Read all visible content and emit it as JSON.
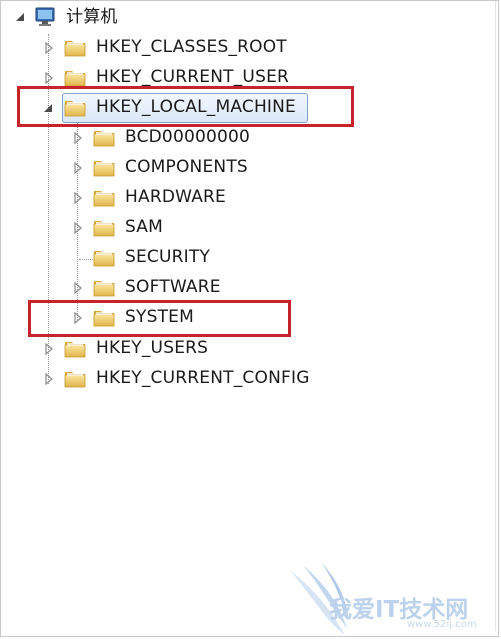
{
  "tree": {
    "root": {
      "label": "计算机",
      "icon": "computer-icon",
      "expanded": true
    },
    "hives": [
      {
        "label": "HKEY_CLASSES_ROOT",
        "expanded": false
      },
      {
        "label": "HKEY_CURRENT_USER",
        "expanded": false
      },
      {
        "label": "HKEY_LOCAL_MACHINE",
        "expanded": true,
        "selected": true
      },
      {
        "label": "HKEY_USERS",
        "expanded": false
      },
      {
        "label": "HKEY_CURRENT_CONFIG",
        "expanded": false
      }
    ],
    "local_machine_children": [
      {
        "label": "BCD00000000",
        "has_children": true
      },
      {
        "label": "COMPONENTS",
        "has_children": true
      },
      {
        "label": "HARDWARE",
        "has_children": true
      },
      {
        "label": "SAM",
        "has_children": true
      },
      {
        "label": "SECURITY",
        "has_children": false
      },
      {
        "label": "SOFTWARE",
        "has_children": true
      },
      {
        "label": "SYSTEM",
        "has_children": true
      }
    ]
  },
  "annotations": {
    "highlight_color": "#c8232c"
  },
  "watermark": {
    "text": "我爱IT技术网",
    "url": "www.52ij.com"
  },
  "colors": {
    "folder": "#e8c35a",
    "selection": "#dbe8f8",
    "selection_border": "#7da2ce"
  }
}
